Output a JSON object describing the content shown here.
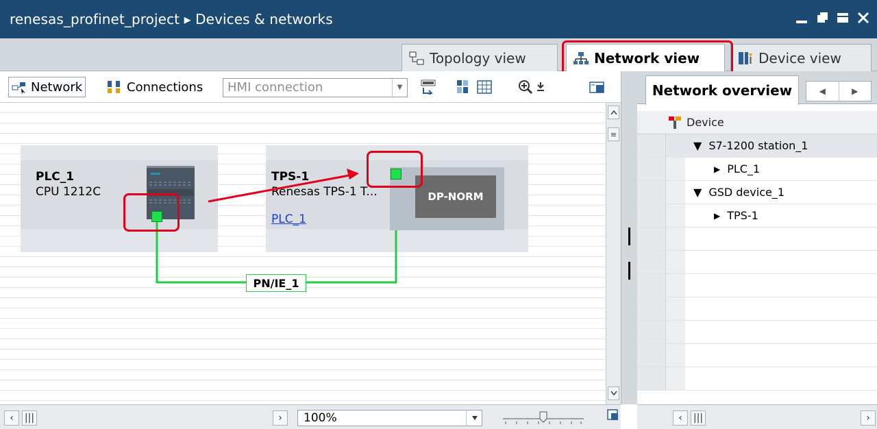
{
  "window": {
    "title": "renesas_profinet_project ▸ Devices & networks",
    "controls": [
      "minimize",
      "restore",
      "maximize",
      "close"
    ]
  },
  "tabs": [
    {
      "label": "Topology view",
      "icon": "topology-icon",
      "active": false
    },
    {
      "label": "Network view",
      "icon": "network-icon",
      "active": true
    },
    {
      "label": "Device view",
      "icon": "device-icon",
      "active": false
    }
  ],
  "toolbar": {
    "network_label": "Network",
    "connections_label": "Connections",
    "connection_type_placeholder": "HMI connection"
  },
  "canvas": {
    "devices": [
      {
        "name": "PLC_1",
        "subtitle": "CPU 1212C"
      },
      {
        "name": "TPS-1",
        "subtitle": "Renesas TPS-1 T...",
        "link": "PLC_1",
        "module_label": "DP-NORM"
      }
    ],
    "subnet_label": "PN/IE_1"
  },
  "bottombar": {
    "zoom": "100%"
  },
  "overview": {
    "tab_label": "Network overview",
    "column_header": "Device",
    "rows": [
      {
        "label": "S7-1200 station_1",
        "level": 0,
        "expanded": true,
        "selected": true
      },
      {
        "label": "PLC_1",
        "level": 1,
        "expanded": false,
        "selected": false
      },
      {
        "label": "GSD device_1",
        "level": 0,
        "expanded": true,
        "selected": false
      },
      {
        "label": "TPS-1",
        "level": 1,
        "expanded": false,
        "selected": false
      }
    ]
  },
  "colors": {
    "titlebar": "#1d4a73",
    "port_green": "#1fe04a",
    "highlight_red": "#e3001b",
    "link_blue": "#1b3fce"
  }
}
